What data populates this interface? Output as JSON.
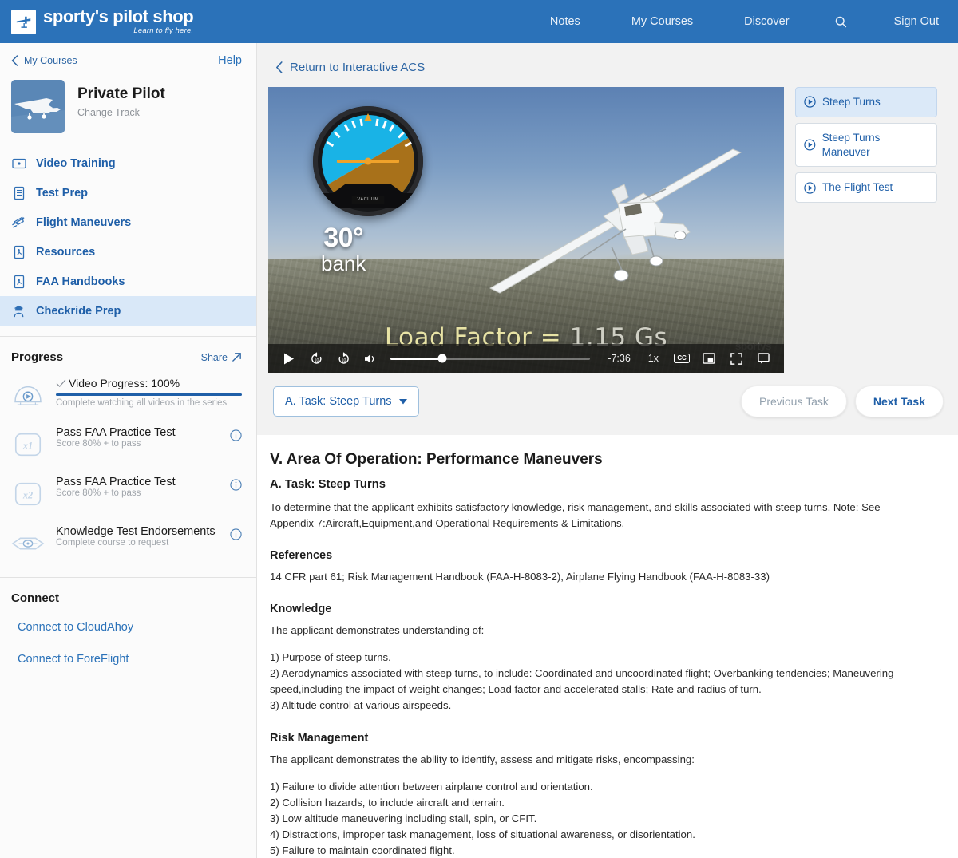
{
  "topnav": {
    "brand_name": "sporty's pilot shop",
    "brand_tagline": "Learn to fly here.",
    "links": [
      {
        "label": "Notes"
      },
      {
        "label": "My Courses"
      },
      {
        "label": "Discover"
      }
    ],
    "search_label": "Search",
    "signout_label": "Sign Out",
    "accent_color": "#2b72b9"
  },
  "sidebar": {
    "back_label": "My Courses",
    "help_label": "Help",
    "course_title": "Private Pilot",
    "course_subtitle": "Change Track",
    "menu": [
      {
        "label": "Video Training",
        "icon": "video-icon",
        "active": false
      },
      {
        "label": "Test Prep",
        "icon": "document-icon",
        "active": false
      },
      {
        "label": "Flight Maneuvers",
        "icon": "airplane-icon",
        "active": false
      },
      {
        "label": "Resources",
        "icon": "pdf-icon",
        "active": false
      },
      {
        "label": "FAA Handbooks",
        "icon": "pdf-icon",
        "active": false
      },
      {
        "label": "Checkride Prep",
        "icon": "pilot-cap-icon",
        "active": true
      }
    ],
    "progress": {
      "title": "Progress",
      "share_label": "Share",
      "items": [
        {
          "title": "Video Progress: 100%",
          "subtitle": "Complete watching all videos in the series",
          "icon": "video-gauge-icon",
          "completed": true,
          "bar_percent": 100,
          "has_info": false
        },
        {
          "title": "Pass FAA Practice Test",
          "subtitle": "Score 80% + to pass",
          "icon": "x1-badge-icon",
          "completed": false,
          "has_info": true
        },
        {
          "title": "Pass FAA Practice Test",
          "subtitle": "Score 80% + to pass",
          "icon": "x2-badge-icon",
          "completed": false,
          "has_info": true
        },
        {
          "title": "Knowledge Test Endorsements",
          "subtitle": "Complete course to request",
          "icon": "wings-badge-icon",
          "completed": false,
          "has_info": true
        }
      ]
    },
    "connect": {
      "title": "Connect",
      "links": [
        {
          "label": "Connect to CloudAhoy"
        },
        {
          "label": "Connect to ForeFlight"
        }
      ]
    }
  },
  "main": {
    "return_link": "Return to Interactive ACS",
    "video": {
      "bank_degrees": "30°",
      "bank_word": "bank",
      "gauge_label": "VACUUM",
      "caption_text": "Load Factor =",
      "caption_value": "1.15 Gs",
      "watermark": "sportys",
      "controls": {
        "play_label": "Play",
        "rewind_label": "Rewind 10 seconds",
        "forward_label": "Forward 10 seconds",
        "volume_label": "Mute",
        "time_remaining": "-7:36",
        "playback_speed": "1x",
        "cc_label": "CC",
        "pip_label": "Picture in picture",
        "fullscreen_label": "Fullscreen",
        "theater_label": "Theater mode",
        "progress_percent": 26
      }
    },
    "playlist": [
      {
        "label": "Steep Turns",
        "active": true
      },
      {
        "label": "Steep Turns Maneuver",
        "active": false
      },
      {
        "label": "The Flight Test",
        "active": false
      }
    ],
    "task_select": "A. Task: Steep Turns",
    "previous_task": "Previous Task",
    "next_task": "Next Task"
  },
  "article": {
    "area_heading": "V. Area Of Operation: Performance Maneuvers",
    "task_heading": "A. Task: Steep Turns",
    "intro": "To determine that the applicant exhibits satisfactory knowledge, risk management, and skills associated with steep turns. Note: See Appendix 7:Aircraft,Equipment,and Operational Requirements & Limitations.",
    "references_heading": "References",
    "references_text": "14 CFR part 61; Risk Management Handbook (FAA-H-8083-2), Airplane Flying Handbook (FAA-H-8083-33)",
    "knowledge_heading": "Knowledge",
    "knowledge_intro": "The applicant demonstrates understanding of:",
    "knowledge_items": "1) Purpose of steep turns.\n2) Aerodynamics associated with steep turns, to include: Coordinated and uncoordinated flight; Overbanking tendencies; Maneuvering speed,including the impact of weight changes; Load factor and accelerated stalls; Rate and radius of turn.\n3) Altitude control at various airspeeds.",
    "risk_heading": "Risk Management",
    "risk_intro": "The applicant demonstrates the ability to identify, assess and mitigate risks, encompassing:",
    "risk_items": "1) Failure to divide attention between airplane control and orientation.\n2) Collision hazards, to include aircraft and terrain.\n3) Low altitude maneuvering including stall, spin, or CFIT.\n4) Distractions, improper task management, loss of situational awareness, or disorientation.\n5) Failure to maintain coordinated flight."
  }
}
